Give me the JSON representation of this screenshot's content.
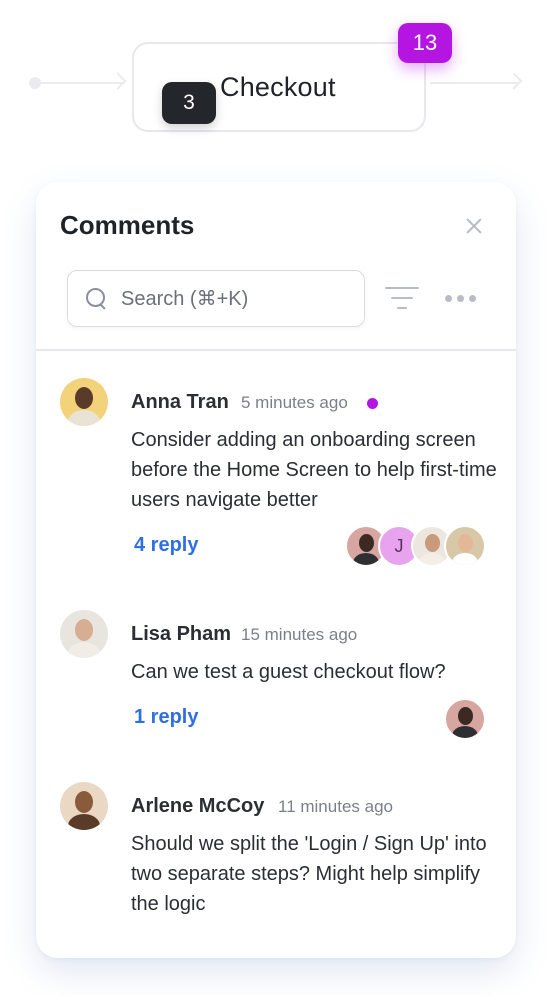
{
  "flow": {
    "node_title": "Checkout",
    "node_badge": "3",
    "comment_count_badge": "13"
  },
  "panel": {
    "title": "Comments",
    "search": {
      "placeholder": "Search (⌘+K)"
    }
  },
  "comments": [
    {
      "author": "Anna Tran",
      "time": "5 minutes ago",
      "unread": true,
      "text": "Consider adding an onboarding screen before the Home Screen to help first-time users navigate better",
      "reply_label": "4 reply",
      "reply_avatars": [
        "avatar-man-dark-hair",
        "J",
        "avatar-woman-bun",
        "avatar-man-curly-hair"
      ]
    },
    {
      "author": "Lisa Pham",
      "time": "15 minutes ago",
      "unread": false,
      "text": "Can we test a guest checkout flow?",
      "reply_label": "1 reply",
      "reply_avatars": [
        "avatar-man-dark-hair"
      ]
    },
    {
      "author": "Arlene McCoy",
      "time": "11 minutes ago",
      "unread": false,
      "text": "Should we split the 'Login / Sign Up' into two separate steps? Might help simplify the logic",
      "reply_label": "",
      "reply_avatars": []
    }
  ],
  "colors": {
    "accent_purple": "#b515e0",
    "reply_link_blue": "#2f6fe4",
    "dark_badge": "#23262b"
  }
}
